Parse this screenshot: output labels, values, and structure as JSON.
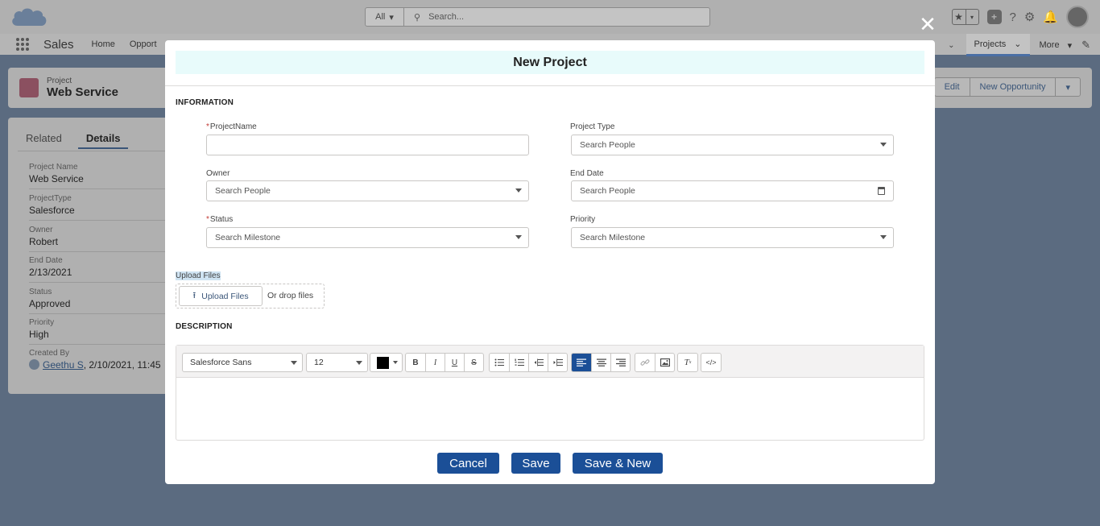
{
  "header": {
    "search_scope": "All",
    "search_placeholder": "Search..."
  },
  "nav": {
    "app_name": "Sales",
    "items": [
      "Home",
      "Opport"
    ],
    "projects": "Projects",
    "more": "More"
  },
  "record": {
    "object_label": "Project",
    "name": "Web Service",
    "actions": [
      "Edit",
      "New Opportunity"
    ]
  },
  "details": {
    "tabs": [
      "Related",
      "Details"
    ],
    "fields": [
      {
        "label": "Project Name",
        "value": "Web Service"
      },
      {
        "label": "ProjectType",
        "value": "Salesforce"
      },
      {
        "label": "Owner",
        "value": "Robert"
      },
      {
        "label": "End Date",
        "value": "2/13/2021"
      },
      {
        "label": "Status",
        "value": "Approved"
      },
      {
        "label": "Priority",
        "value": "High"
      }
    ],
    "created_by_label": "Created By",
    "created_by_user": "Geethu S",
    "created_by_date": ", 2/10/2021, 11:45"
  },
  "modal": {
    "title": "New Project",
    "section_information": "INFORMATION",
    "project_name_label": "ProjectName",
    "project_name_value": "",
    "project_type_label": "Project Type",
    "project_type_placeholder": "Search People",
    "owner_label": "Owner",
    "owner_placeholder": "Search People",
    "end_date_label": "End Date",
    "end_date_placeholder": "Search People",
    "status_label": "Status",
    "status_placeholder": "Search Milestone",
    "priority_label": "Priority",
    "priority_placeholder": "Search Milestone",
    "upload_label": "Upload Files",
    "upload_button": "Upload Files",
    "drop_hint": "Or drop files",
    "section_description": "DESCRIPTION",
    "editor": {
      "font": "Salesforce Sans",
      "size": "12",
      "text_color": "#000000"
    },
    "buttons": {
      "cancel": "Cancel",
      "save": "Save",
      "save_new": "Save & New"
    }
  }
}
